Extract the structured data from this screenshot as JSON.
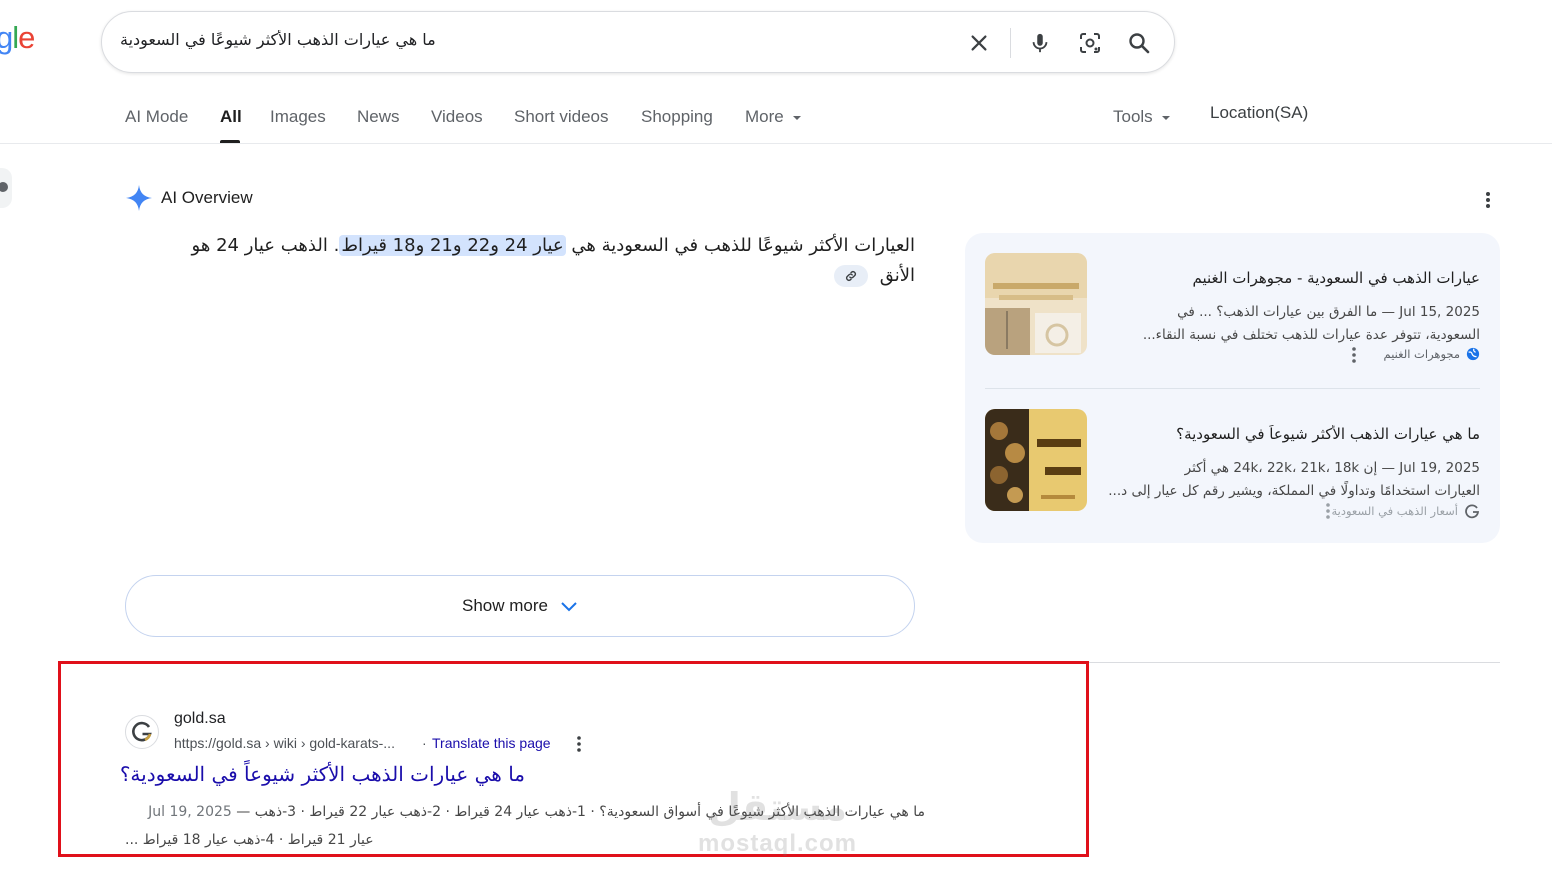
{
  "logo": {
    "part1": "g",
    "part2": "l",
    "part3": "e"
  },
  "search": {
    "query": "ما هي عيارات الذهب الأكثر شيوعًا في السعودية"
  },
  "tabs": [
    {
      "label": "AI Mode"
    },
    {
      "label": "All"
    },
    {
      "label": "Images"
    },
    {
      "label": "News"
    },
    {
      "label": "Videos"
    },
    {
      "label": "Short videos"
    },
    {
      "label": "Shopping"
    },
    {
      "label": "More"
    }
  ],
  "tools_label": "Tools",
  "location_label": "Location(SA)",
  "ai_overview": {
    "title": "AI Overview",
    "answer_pre": "العيارات الأكثر شيوعًا للذهب في السعودية هي ",
    "answer_highlight": "عيار 24 و22 و21 و18 قيراط",
    "answer_post": ". الذهب عيار 24 هو الأنق",
    "show_more": "Show more"
  },
  "sources": [
    {
      "title": "عيارات الذهب في السعودية - مجوهرات الغنيم",
      "snippet_line1": "Jul 15, 2025 — ما الفرق بين عيارات الذهب؟ ... في",
      "snippet_line2": "السعودية، تتوفر عدة عيارات للذهب تختلف في نسبة النقاء...",
      "site": "مجوهرات الغنيم"
    },
    {
      "title": "ما هي عيارات الذهب الأكثر شيوعاً في السعودية؟",
      "snippet_line1": "Jul 19, 2025 — إن 24k، 22k، 21k، 18k هي أكثر",
      "snippet_line2": "العيارات استخدامًا وتداولًا في المملكة، ويشير رقم كل عيار إلى د...",
      "site": "أسعار الذهب في السعودية"
    }
  ],
  "result": {
    "site_name": "gold.sa",
    "url": "https://gold.sa › wiki › gold-karats-...",
    "translate": "Translate this page",
    "title": "ما هي عيارات الذهب الأكثر شيوعاً في السعودية؟",
    "date": "Jul 19, 2025",
    "snippet_line1": "ما هي عيارات الذهب الأكثر شيوعًا في أسواق السعودية؟ · 1-ذهب عيار 24 قيراط · 2-ذهب عيار 22 قيراط · 3-ذهب",
    "snippet_line2": "عيار 21 قيراط · 4-ذهب عيار 18 قيراط ..."
  },
  "watermark": {
    "arabic": "مستقل",
    "latin": "mostaql.com"
  },
  "colors": {
    "link": "#1a0dab",
    "highlight": "#d3e3fd",
    "annotation_box": "#e0101a",
    "ai_star": "#4285f4"
  }
}
